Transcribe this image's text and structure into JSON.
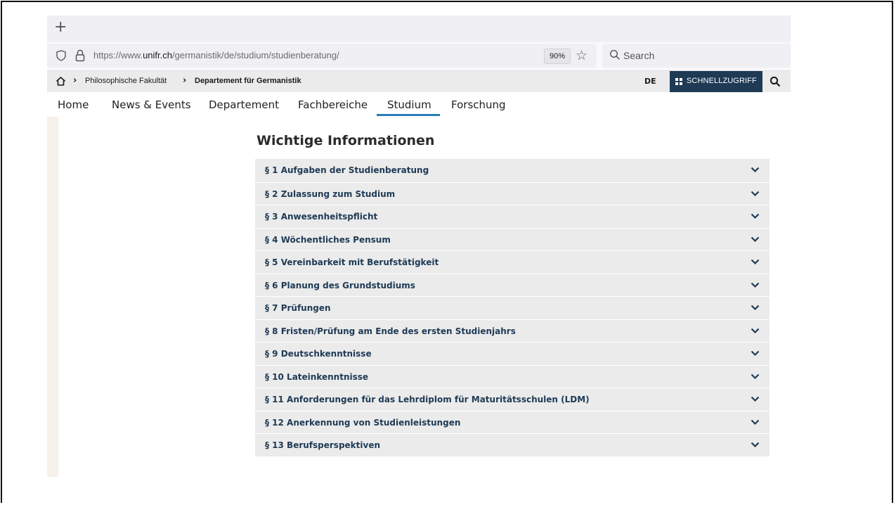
{
  "browser": {
    "new_tab": "+",
    "url_prefix": "https://www.",
    "url_domain": "unifr.ch",
    "url_path": "/germanistik/de/studium/studienberatung/",
    "zoom": "90%",
    "search_placeholder": "Search"
  },
  "site": {
    "breadcrumb": [
      "Philosophische Fakultät",
      "Departement für Germanistik"
    ],
    "language": "DE",
    "quick_access": "SCHNELLZUGRIFF",
    "nav": [
      "Home",
      "News & Events",
      "Departement",
      "Fachbereiche",
      "Studium",
      "Forschung"
    ],
    "active_nav": "Studium"
  },
  "main": {
    "title": "Wichtige Informationen",
    "items": [
      "§ 1 Aufgaben der Studienberatung",
      "§ 2 Zulassung zum Studium",
      "§ 3 Anwesenheitspflicht",
      "§ 4 Wöchentliches Pensum",
      "§ 5 Vereinbarkeit mit Berufstätigkeit",
      "§ 6 Planung des Grundstudiums",
      "§ 7 Prüfungen",
      "§ 8 Fristen/Prüfung am Ende des ersten Studienjahrs",
      "§ 9 Deutschkenntnisse",
      "§ 10 Lateinkenntnisse",
      "§ 11 Anforderungen für das Lehrdiplom für Maturitätsschulen (LDM)",
      "§ 12 Anerkennung von Studienleistungen",
      "§ 13 Berufsperspektiven"
    ]
  },
  "colors": {
    "accent": "#2a7fb8",
    "brand": "#1e3a55"
  }
}
